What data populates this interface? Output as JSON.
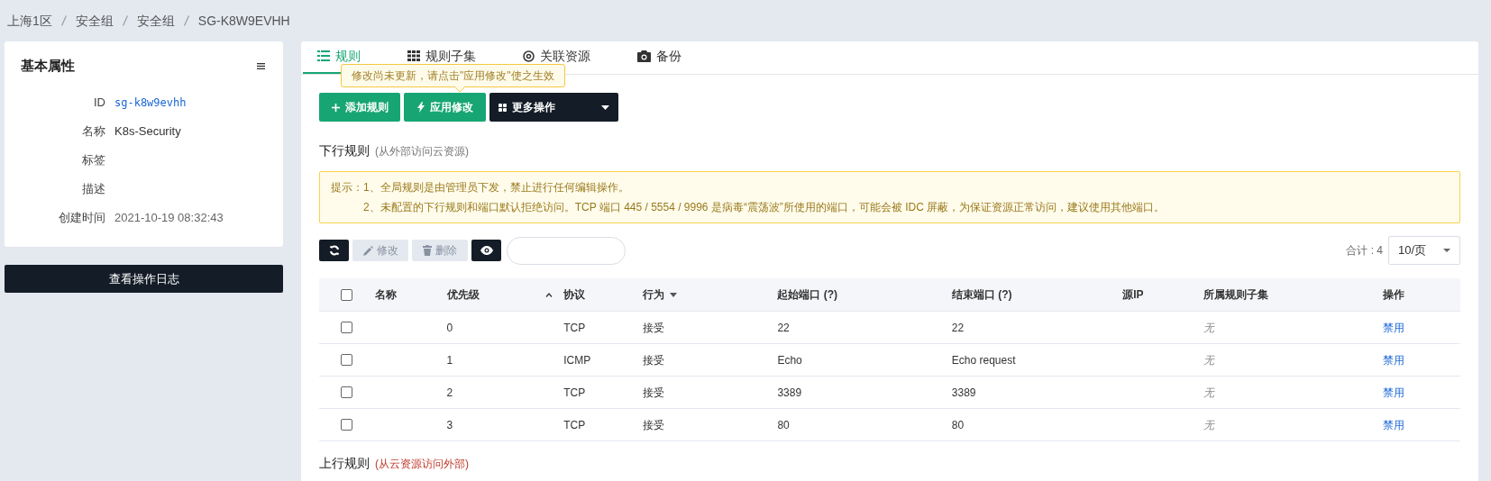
{
  "breadcrumb": [
    "上海1区",
    "安全组",
    "安全组",
    "SG-K8W9EVHH"
  ],
  "properties": {
    "title": "基本属性",
    "fields": [
      {
        "label": "ID",
        "value": "sg-k8w9evhh",
        "kind": "code"
      },
      {
        "label": "名称",
        "value": "K8s-Security",
        "kind": "text"
      },
      {
        "label": "标签",
        "kind": "text"
      },
      {
        "label": "描述",
        "kind": "text"
      },
      {
        "label": "创建时间",
        "value": "2021-10-19 08:32:43",
        "kind": "muted"
      }
    ]
  },
  "log_button": "查看操作日志",
  "tabs": [
    {
      "label": "规则",
      "selected": true
    },
    {
      "label": "规则子集",
      "selected": false
    },
    {
      "label": "关联资源",
      "selected": false
    },
    {
      "label": "备份",
      "selected": false
    }
  ],
  "tooltip": "修改尚未更新，请点击\"应用修改\"使之生效",
  "actions": [
    {
      "label": "添加规则",
      "kind": "add"
    },
    {
      "label": "应用修改",
      "kind": "apply"
    },
    {
      "label": "更多操作",
      "kind": "more"
    }
  ],
  "section": {
    "title": "下行规则",
    "subtitle": "(从外部访问云资源)"
  },
  "notice": {
    "prefix": "提示：",
    "lines": [
      "1、全局规则是由管理员下发，禁止进行任何编辑操作。",
      "2、未配置的下行规则和端口默认拒绝访问。TCP 端口 445 / 5554 / 9996 是病毒“震荡波”所使用的端口，可能会被 IDC 屏蔽，为保证资源正常访问，建议使用其他端口。"
    ]
  },
  "toolbar": [
    {
      "kind": "refresh",
      "disabled": false
    },
    {
      "kind": "edit",
      "label": "修改",
      "disabled": true
    },
    {
      "kind": "delete",
      "label": "删除",
      "disabled": true
    },
    {
      "kind": "view",
      "disabled": false
    }
  ],
  "total": "合计 : 4",
  "page_size": "10/页",
  "table": {
    "select_all_checked": false,
    "columns": [
      "名称",
      "优先级",
      "协议",
      "行为",
      "起始端口 (?)",
      "结束端口 (?)",
      "源IP",
      "所属规则子集",
      "操作"
    ],
    "rows": [
      {
        "checked": false,
        "priority": "0",
        "protocol": "TCP",
        "action": "接受",
        "start": "22",
        "end": "22",
        "subset": "无",
        "op": "禁用"
      },
      {
        "checked": false,
        "priority": "1",
        "protocol": "ICMP",
        "action": "接受",
        "start": "Echo",
        "end": "Echo request",
        "subset": "无",
        "op": "禁用"
      },
      {
        "checked": false,
        "priority": "2",
        "protocol": "TCP",
        "action": "接受",
        "start": "3389",
        "end": "3389",
        "subset": "无",
        "op": "禁用"
      },
      {
        "checked": false,
        "priority": "3",
        "protocol": "TCP",
        "action": "接受",
        "start": "80",
        "end": "80",
        "subset": "无",
        "op": "禁用"
      }
    ]
  },
  "next_section": {
    "title": "上行规则",
    "subtitle": "(从云资源访问外部)"
  }
}
